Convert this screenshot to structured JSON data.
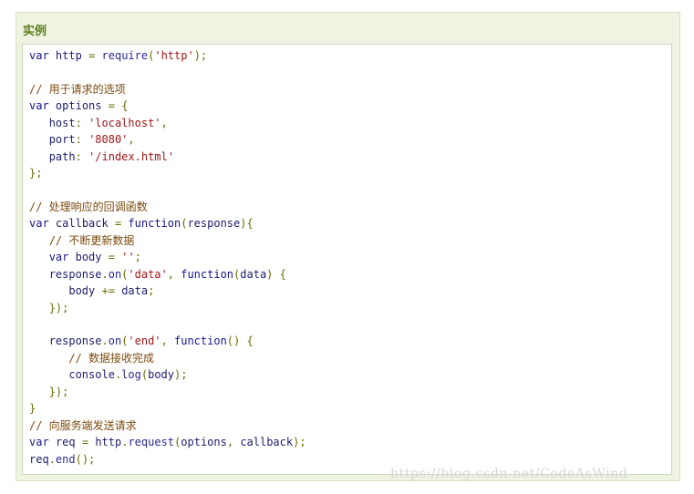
{
  "panel": {
    "title": "实例"
  },
  "code": {
    "lines": [
      [
        {
          "t": "kw",
          "v": "var"
        },
        {
          "t": "txt",
          "v": " "
        },
        {
          "t": "id",
          "v": "http"
        },
        {
          "t": "txt",
          "v": " "
        },
        {
          "t": "pun",
          "v": "="
        },
        {
          "t": "txt",
          "v": " "
        },
        {
          "t": "fn",
          "v": "require"
        },
        {
          "t": "pun",
          "v": "("
        },
        {
          "t": "str",
          "v": "'http'"
        },
        {
          "t": "pun",
          "v": ");"
        }
      ],
      [],
      [
        {
          "t": "com",
          "v": "// 用于请求的选项"
        }
      ],
      [
        {
          "t": "kw",
          "v": "var"
        },
        {
          "t": "txt",
          "v": " "
        },
        {
          "t": "id",
          "v": "options"
        },
        {
          "t": "txt",
          "v": " "
        },
        {
          "t": "pun",
          "v": "="
        },
        {
          "t": "txt",
          "v": " "
        },
        {
          "t": "pun",
          "v": "{"
        }
      ],
      [
        {
          "t": "txt",
          "v": "   "
        },
        {
          "t": "id",
          "v": "host"
        },
        {
          "t": "pun",
          "v": ":"
        },
        {
          "t": "txt",
          "v": " "
        },
        {
          "t": "str",
          "v": "'localhost'"
        },
        {
          "t": "pun",
          "v": ","
        }
      ],
      [
        {
          "t": "txt",
          "v": "   "
        },
        {
          "t": "id",
          "v": "port"
        },
        {
          "t": "pun",
          "v": ":"
        },
        {
          "t": "txt",
          "v": " "
        },
        {
          "t": "str",
          "v": "'8080'"
        },
        {
          "t": "pun",
          "v": ","
        }
      ],
      [
        {
          "t": "txt",
          "v": "   "
        },
        {
          "t": "id",
          "v": "path"
        },
        {
          "t": "pun",
          "v": ":"
        },
        {
          "t": "txt",
          "v": " "
        },
        {
          "t": "str",
          "v": "'/index.html'"
        }
      ],
      [
        {
          "t": "pun",
          "v": "};"
        }
      ],
      [],
      [
        {
          "t": "com",
          "v": "// 处理响应的回调函数"
        }
      ],
      [
        {
          "t": "kw",
          "v": "var"
        },
        {
          "t": "txt",
          "v": " "
        },
        {
          "t": "id",
          "v": "callback"
        },
        {
          "t": "txt",
          "v": " "
        },
        {
          "t": "pun",
          "v": "="
        },
        {
          "t": "txt",
          "v": " "
        },
        {
          "t": "kw",
          "v": "function"
        },
        {
          "t": "pun",
          "v": "("
        },
        {
          "t": "id",
          "v": "response"
        },
        {
          "t": "pun",
          "v": "){"
        }
      ],
      [
        {
          "t": "txt",
          "v": "   "
        },
        {
          "t": "com",
          "v": "// 不断更新数据"
        }
      ],
      [
        {
          "t": "txt",
          "v": "   "
        },
        {
          "t": "kw",
          "v": "var"
        },
        {
          "t": "txt",
          "v": " "
        },
        {
          "t": "id",
          "v": "body"
        },
        {
          "t": "txt",
          "v": " "
        },
        {
          "t": "pun",
          "v": "="
        },
        {
          "t": "txt",
          "v": " "
        },
        {
          "t": "str",
          "v": "''"
        },
        {
          "t": "pun",
          "v": ";"
        }
      ],
      [
        {
          "t": "txt",
          "v": "   "
        },
        {
          "t": "id",
          "v": "response"
        },
        {
          "t": "pun",
          "v": "."
        },
        {
          "t": "fn",
          "v": "on"
        },
        {
          "t": "pun",
          "v": "("
        },
        {
          "t": "str",
          "v": "'data'"
        },
        {
          "t": "pun",
          "v": ","
        },
        {
          "t": "txt",
          "v": " "
        },
        {
          "t": "kw",
          "v": "function"
        },
        {
          "t": "pun",
          "v": "("
        },
        {
          "t": "id",
          "v": "data"
        },
        {
          "t": "pun",
          "v": ")"
        },
        {
          "t": "txt",
          "v": " "
        },
        {
          "t": "pun",
          "v": "{"
        }
      ],
      [
        {
          "t": "txt",
          "v": "      "
        },
        {
          "t": "id",
          "v": "body"
        },
        {
          "t": "txt",
          "v": " "
        },
        {
          "t": "pun",
          "v": "+="
        },
        {
          "t": "txt",
          "v": " "
        },
        {
          "t": "id",
          "v": "data"
        },
        {
          "t": "pun",
          "v": ";"
        }
      ],
      [
        {
          "t": "txt",
          "v": "   "
        },
        {
          "t": "pun",
          "v": "});"
        }
      ],
      [],
      [
        {
          "t": "txt",
          "v": "   "
        },
        {
          "t": "id",
          "v": "response"
        },
        {
          "t": "pun",
          "v": "."
        },
        {
          "t": "fn",
          "v": "on"
        },
        {
          "t": "pun",
          "v": "("
        },
        {
          "t": "str",
          "v": "'end'"
        },
        {
          "t": "pun",
          "v": ","
        },
        {
          "t": "txt",
          "v": " "
        },
        {
          "t": "kw",
          "v": "function"
        },
        {
          "t": "pun",
          "v": "()"
        },
        {
          "t": "txt",
          "v": " "
        },
        {
          "t": "pun",
          "v": "{"
        }
      ],
      [
        {
          "t": "txt",
          "v": "      "
        },
        {
          "t": "com",
          "v": "// 数据接收完成"
        }
      ],
      [
        {
          "t": "txt",
          "v": "      "
        },
        {
          "t": "id",
          "v": "console"
        },
        {
          "t": "pun",
          "v": "."
        },
        {
          "t": "fn",
          "v": "log"
        },
        {
          "t": "pun",
          "v": "("
        },
        {
          "t": "id",
          "v": "body"
        },
        {
          "t": "pun",
          "v": ");"
        }
      ],
      [
        {
          "t": "txt",
          "v": "   "
        },
        {
          "t": "pun",
          "v": "});"
        }
      ],
      [
        {
          "t": "pun",
          "v": "}"
        }
      ],
      [
        {
          "t": "com",
          "v": "// 向服务端发送请求"
        }
      ],
      [
        {
          "t": "kw",
          "v": "var"
        },
        {
          "t": "txt",
          "v": " "
        },
        {
          "t": "id",
          "v": "req"
        },
        {
          "t": "txt",
          "v": " "
        },
        {
          "t": "pun",
          "v": "="
        },
        {
          "t": "txt",
          "v": " "
        },
        {
          "t": "id",
          "v": "http"
        },
        {
          "t": "pun",
          "v": "."
        },
        {
          "t": "fn",
          "v": "request"
        },
        {
          "t": "pun",
          "v": "("
        },
        {
          "t": "id",
          "v": "options"
        },
        {
          "t": "pun",
          "v": ","
        },
        {
          "t": "txt",
          "v": " "
        },
        {
          "t": "id",
          "v": "callback"
        },
        {
          "t": "pun",
          "v": ");"
        }
      ],
      [
        {
          "t": "id",
          "v": "req"
        },
        {
          "t": "pun",
          "v": "."
        },
        {
          "t": "fn",
          "v": "end"
        },
        {
          "t": "pun",
          "v": "();"
        }
      ]
    ]
  },
  "watermark": {
    "text": "https://blog.csdn.net/CodeAsWind"
  },
  "colors": {
    "panel_background": "#eef3e2",
    "title": "#5b7f1f",
    "keyword": "#14148a",
    "string": "#a31515",
    "comment": "#7b4a0e",
    "punctuation": "#6b6b00"
  }
}
